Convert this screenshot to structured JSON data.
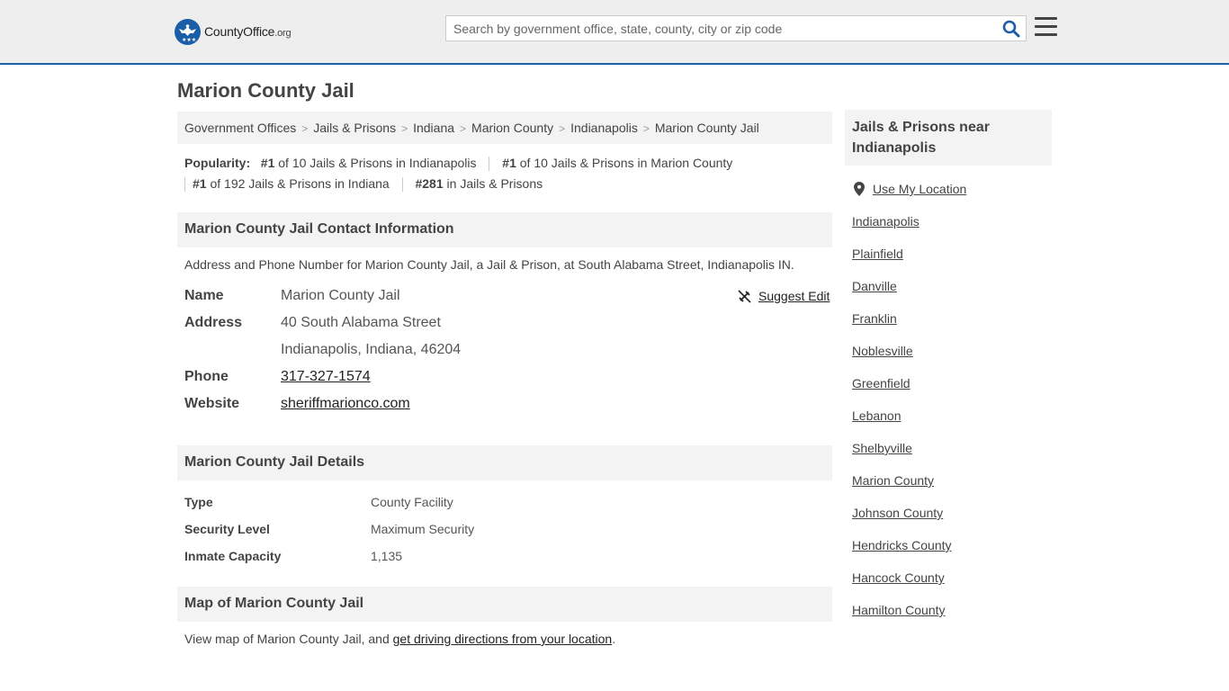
{
  "header": {
    "logo_main": "CountyOffice",
    "logo_suffix": ".org",
    "search_placeholder": "Search by government office, state, county, city or zip code"
  },
  "page": {
    "title": "Marion County Jail",
    "breadcrumbs": [
      "Government Offices",
      "Jails & Prisons",
      "Indiana",
      "Marion County",
      "Indianapolis",
      "Marion County Jail"
    ],
    "popularity": {
      "label": "Popularity:",
      "items": [
        {
          "rank": "#1",
          "text": "of 10 Jails & Prisons in Indianapolis"
        },
        {
          "rank": "#1",
          "text": "of 10 Jails & Prisons in Marion County"
        },
        {
          "rank": "#1",
          "text": "of 192 Jails & Prisons in Indiana"
        },
        {
          "rank": "#281",
          "text": "in Jails & Prisons"
        }
      ]
    }
  },
  "contact": {
    "heading": "Marion County Jail Contact Information",
    "description": "Address and Phone Number for Marion County Jail, a Jail & Prison, at South Alabama Street, Indianapolis IN.",
    "suggest_edit": "Suggest Edit",
    "name_label": "Name",
    "name": "Marion County Jail",
    "address_label": "Address",
    "address_line1": "40 South Alabama Street",
    "address_line2": "Indianapolis, Indiana, 46204",
    "phone_label": "Phone",
    "phone": "317-327-1574",
    "website_label": "Website",
    "website": "sheriffmarionco.com"
  },
  "details": {
    "heading": "Marion County Jail Details",
    "rows": [
      {
        "label": "Type",
        "value": "County Facility"
      },
      {
        "label": "Security Level",
        "value": "Maximum Security"
      },
      {
        "label": "Inmate Capacity",
        "value": "1,135"
      }
    ]
  },
  "map": {
    "heading": "Map of Marion County Jail",
    "text": "View map of Marion County Jail, and ",
    "link": "get driving directions from your location",
    "period": "."
  },
  "sidebar": {
    "heading": "Jails & Prisons near Indianapolis",
    "use_location": "Use My Location",
    "links": [
      "Indianapolis",
      "Plainfield",
      "Danville",
      "Franklin",
      "Noblesville",
      "Greenfield",
      "Lebanon",
      "Shelbyville",
      "Marion County",
      "Johnson County",
      "Hendricks County",
      "Hancock County",
      "Hamilton County"
    ]
  },
  "colors": {
    "brand_blue": "#1b5ea8",
    "header_bg": "#eeeeee",
    "section_bg": "#f3f3f3"
  }
}
